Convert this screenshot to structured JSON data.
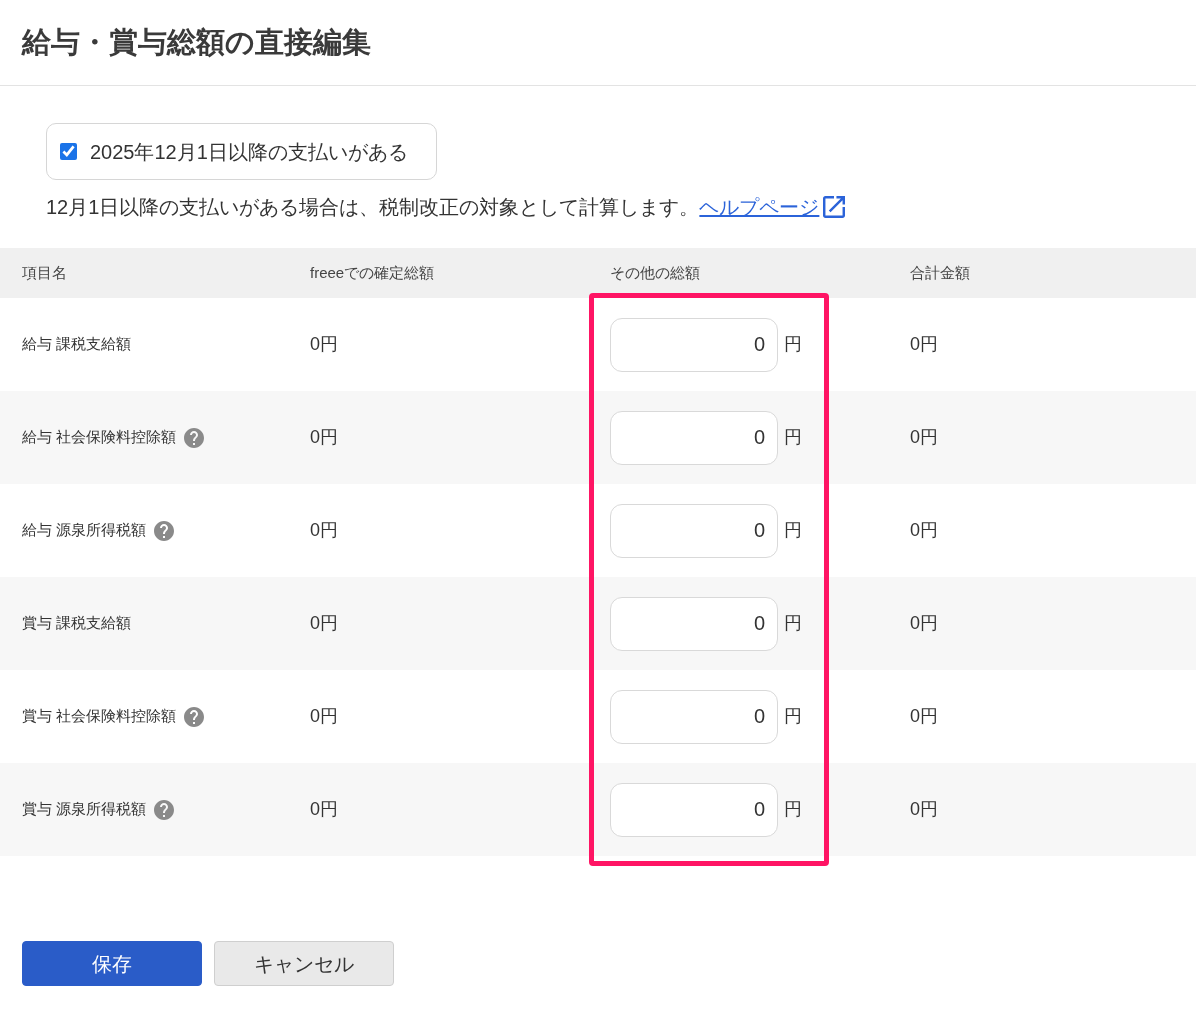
{
  "title": "給与・賞与総額の直接編集",
  "checkbox": {
    "label": "2025年12月1日以降の支払いがある",
    "checked": true
  },
  "note": {
    "text": "12月1日以降の支払いがある場合は、税制改正の対象として計算します。",
    "link": "ヘルプページ"
  },
  "table": {
    "columns": [
      {
        "label": "項目名",
        "highlighted": false
      },
      {
        "label": "freeeでの確定総額",
        "highlighted": false
      },
      {
        "label": "その他の総額",
        "highlighted": true
      },
      {
        "label": "合計金額",
        "highlighted": false
      }
    ],
    "rows": [
      {
        "name": "給与 課税支給額",
        "help": false,
        "confirmed": "0円",
        "other": "0",
        "unit": "円",
        "total": "0円"
      },
      {
        "name": "給与 社会保険料控除額",
        "help": true,
        "confirmed": "0円",
        "other": "0",
        "unit": "円",
        "total": "0円"
      },
      {
        "name": "給与 源泉所得税額",
        "help": true,
        "confirmed": "0円",
        "other": "0",
        "unit": "円",
        "total": "0円"
      },
      {
        "name": "賞与 課税支給額",
        "help": false,
        "confirmed": "0円",
        "other": "0",
        "unit": "円",
        "total": "0円"
      },
      {
        "name": "賞与 社会保険料控除額",
        "help": true,
        "confirmed": "0円",
        "other": "0",
        "unit": "円",
        "total": "0円"
      },
      {
        "name": "賞与 源泉所得税額",
        "help": true,
        "confirmed": "0円",
        "other": "0",
        "unit": "円",
        "total": "0円"
      }
    ]
  },
  "buttons": [
    {
      "label": "保存",
      "kind": "primary"
    },
    {
      "label": "キャンセル",
      "kind": "secondary"
    }
  ]
}
